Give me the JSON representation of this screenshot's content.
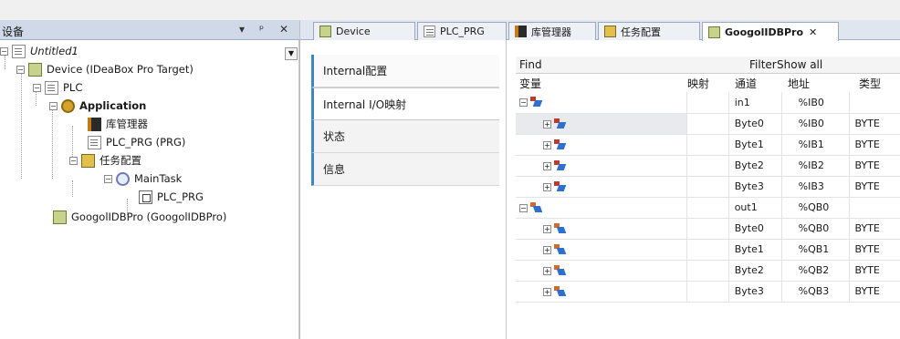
{
  "devices_panel": {
    "title": "设备",
    "pin_glyph": "▾ ᵖ",
    "close_glyph": "✕",
    "tree": [
      {
        "label": "Untitled1",
        "style": "italic"
      },
      {
        "label": "Device (IDeaBox Pro Target)",
        "style": "normal"
      },
      {
        "label": "PLC",
        "style": "normal"
      },
      {
        "label": "Application",
        "style": "bold"
      },
      {
        "label": "库管理器",
        "style": "normal"
      },
      {
        "label": "PLC_PRG (PRG)",
        "style": "normal"
      },
      {
        "label": "任务配置",
        "style": "normal"
      },
      {
        "label": "MainTask",
        "style": "normal"
      },
      {
        "label": "PLC_PRG",
        "style": "normal"
      },
      {
        "label": "GoogolIDBPro (GoogolIDBPro)",
        "style": "normal"
      }
    ]
  },
  "editor": {
    "tabs": [
      {
        "label": "Device",
        "icon": "device-icon"
      },
      {
        "label": "PLC_PRG",
        "icon": "page-icon"
      },
      {
        "label": "库管理器",
        "icon": "library-icon"
      },
      {
        "label": "任务配置",
        "icon": "task-icon"
      },
      {
        "label": "GoogolIDBPro",
        "icon": "device-icon",
        "active": true,
        "close": "✕"
      }
    ],
    "side_tabs": [
      "Internal配置",
      "Internal I/O映射",
      "状态",
      "信息"
    ],
    "find_label": "Find",
    "filter_label": "Filter",
    "show_all_label": "Show all",
    "columns": [
      "变量",
      "映射",
      "通道",
      "地址",
      "类型"
    ],
    "rows": [
      {
        "channel": "in1",
        "address": "%IB0",
        "type": "",
        "kind": "in",
        "level": 0,
        "selected": false
      },
      {
        "channel": "Byte0",
        "address": "%IB0",
        "type": "BYTE",
        "kind": "in",
        "level": 1,
        "selected": true
      },
      {
        "channel": "Byte1",
        "address": "%IB1",
        "type": "BYTE",
        "kind": "in",
        "level": 1,
        "selected": false
      },
      {
        "channel": "Byte2",
        "address": "%IB2",
        "type": "BYTE",
        "kind": "in",
        "level": 1,
        "selected": false
      },
      {
        "channel": "Byte3",
        "address": "%IB3",
        "type": "BYTE",
        "kind": "in",
        "level": 1,
        "selected": false
      },
      {
        "channel": "out1",
        "address": "%QB0",
        "type": "",
        "kind": "out",
        "level": 0,
        "selected": false
      },
      {
        "channel": "Byte0",
        "address": "%QB0",
        "type": "BYTE",
        "kind": "out",
        "level": 1,
        "selected": false
      },
      {
        "channel": "Byte1",
        "address": "%QB1",
        "type": "BYTE",
        "kind": "out",
        "level": 1,
        "selected": false
      },
      {
        "channel": "Byte2",
        "address": "%QB2",
        "type": "BYTE",
        "kind": "out",
        "level": 1,
        "selected": false
      },
      {
        "channel": "Byte3",
        "address": "%QB3",
        "type": "BYTE",
        "kind": "out",
        "level": 1,
        "selected": false
      }
    ]
  },
  "colors": {
    "header_bg": "#cfd9e8",
    "accent": "#3a86c6",
    "selected_row": "#e9eaee"
  }
}
